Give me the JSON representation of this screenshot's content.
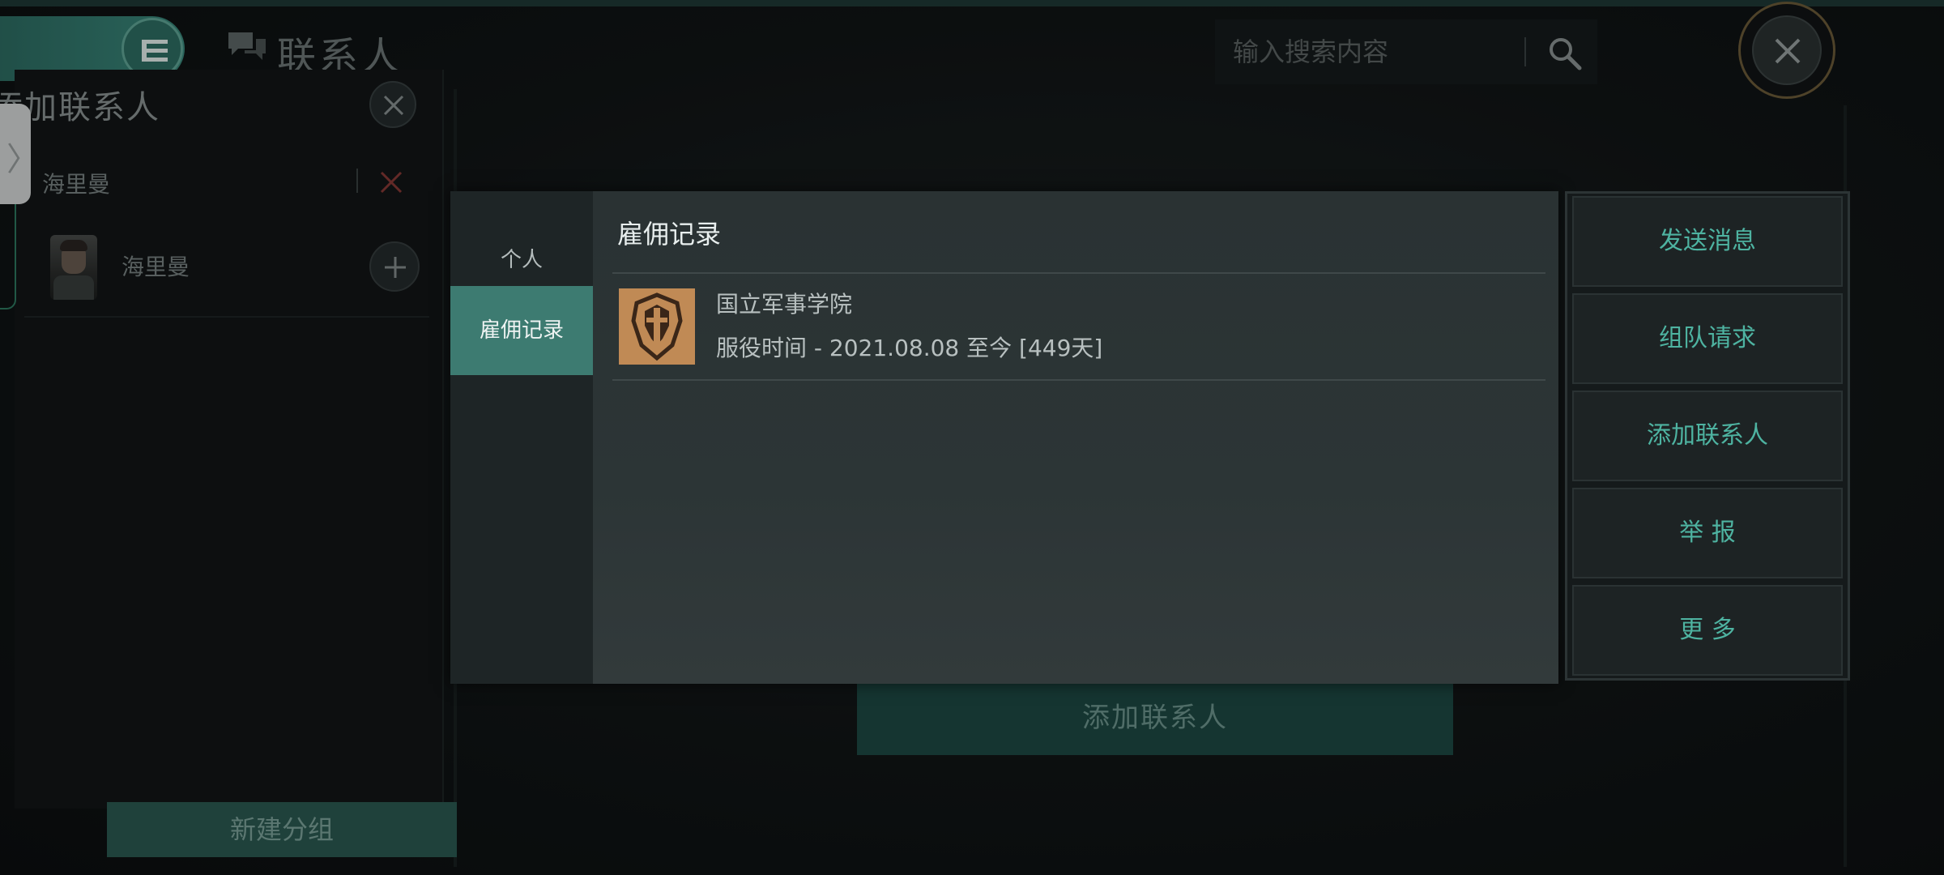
{
  "header": {
    "title": "联系人",
    "search_placeholder": "输入搜索内容"
  },
  "left_panel": {
    "title": "添加联系人",
    "search_value": "海里曼",
    "contacts": [
      {
        "name": "海里曼"
      }
    ],
    "new_group_label": "新建分组"
  },
  "background": {
    "add_contact_label": "添加联系人"
  },
  "modal": {
    "nav": [
      {
        "label": "个人",
        "active": false
      },
      {
        "label": "雇佣记录",
        "active": true
      }
    ],
    "section_title": "雇佣记录",
    "records": [
      {
        "organization": "国立军事学院",
        "service": "服役时间 - 2021.08.08 至今 [449天]"
      }
    ]
  },
  "actions": [
    {
      "label": "发送消息"
    },
    {
      "label": "组队请求"
    },
    {
      "label": "添加联系人"
    },
    {
      "label": "举 报"
    },
    {
      "label": "更 多"
    }
  ],
  "colors": {
    "accent": "#3d7b71",
    "action_text": "#4eb3a1",
    "emblem": "#c08a55",
    "background": "#111516"
  }
}
